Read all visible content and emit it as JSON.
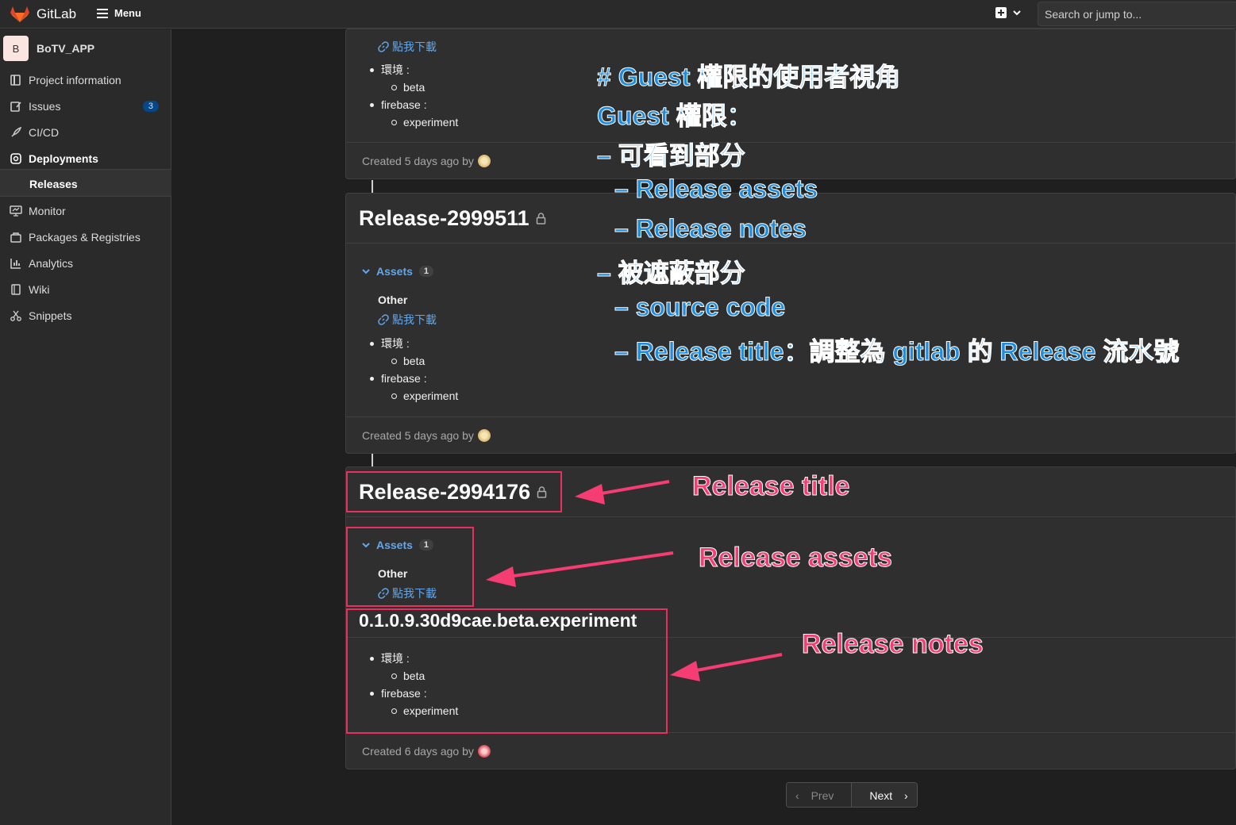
{
  "header": {
    "brand": "GitLab",
    "menu_label": "Menu",
    "search_placeholder": "Search or jump to..."
  },
  "sidebar": {
    "project_initial": "B",
    "project_name": "BoTV_APP",
    "items": [
      {
        "label": "Project information",
        "icon": "info-icon"
      },
      {
        "label": "Issues",
        "icon": "issues-icon",
        "badge": "3"
      },
      {
        "label": "CI/CD",
        "icon": "rocket-icon"
      },
      {
        "label": "Deployments",
        "icon": "deployments-icon"
      },
      {
        "label": "Monitor",
        "icon": "monitor-icon"
      },
      {
        "label": "Packages & Registries",
        "icon": "package-icon"
      },
      {
        "label": "Analytics",
        "icon": "analytics-icon"
      },
      {
        "label": "Wiki",
        "icon": "book-icon"
      },
      {
        "label": "Snippets",
        "icon": "snippet-icon"
      }
    ],
    "active_sub": "Releases"
  },
  "releases": [
    {
      "download_label": "點我下載",
      "env_label": "環境 :",
      "env_value": "beta",
      "firebase_label": "firebase :",
      "firebase_value": "experiment",
      "created": "Created 5 days ago by"
    },
    {
      "title": "Release-2999511",
      "assets_label": "Assets",
      "assets_count": "1",
      "asset_group": "Other",
      "download_label": "點我下載",
      "env_label": "環境 :",
      "env_value": "beta",
      "firebase_label": "firebase :",
      "firebase_value": "experiment",
      "created": "Created 5 days ago by"
    },
    {
      "title": "Release-2994176",
      "assets_label": "Assets",
      "assets_count": "1",
      "asset_group": "Other",
      "download_label": "點我下載",
      "notes_heading": "0.1.0.9.30d9cae.beta.experiment",
      "env_label": "環境 :",
      "env_value": "beta",
      "firebase_label": "firebase :",
      "firebase_value": "experiment",
      "created": "Created 6 days ago by"
    }
  ],
  "pagination": {
    "prev": "Prev",
    "next": "Next"
  },
  "annotations": {
    "blue": [
      "# Guest 權限的使用者視角",
      "Guest 權限：",
      "– 可看到部分",
      "– Release assets",
      "– Release notes",
      "– 被遮蔽部分",
      "– source code",
      "– Release title：調整為 gitlab 的 Release 流水號"
    ],
    "pink": [
      "Release title",
      "Release assets",
      "Release notes"
    ]
  },
  "colors": {
    "accent_link": "#63a6e9",
    "annotation_blue": "#1f8ce0",
    "annotation_pink": "#f53d73"
  }
}
